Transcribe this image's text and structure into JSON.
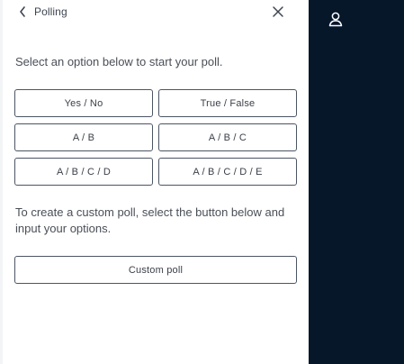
{
  "header": {
    "title": "Polling",
    "back_icon": "chevron-left-icon",
    "close_icon": "close-icon"
  },
  "instruction": "Select an option below to start your poll.",
  "options": [
    "Yes / No",
    "True / False",
    "A / B",
    "A / B / C",
    "A / B / C / D",
    "A / B / C / D / E"
  ],
  "custom": {
    "text": "To create a custom poll, select the button below and input your options.",
    "button_label": "Custom poll"
  },
  "sidebar": {
    "icon": "user-icon"
  },
  "colors": {
    "sidebar_bg": "#06172a",
    "button_border": "#4b5563"
  }
}
